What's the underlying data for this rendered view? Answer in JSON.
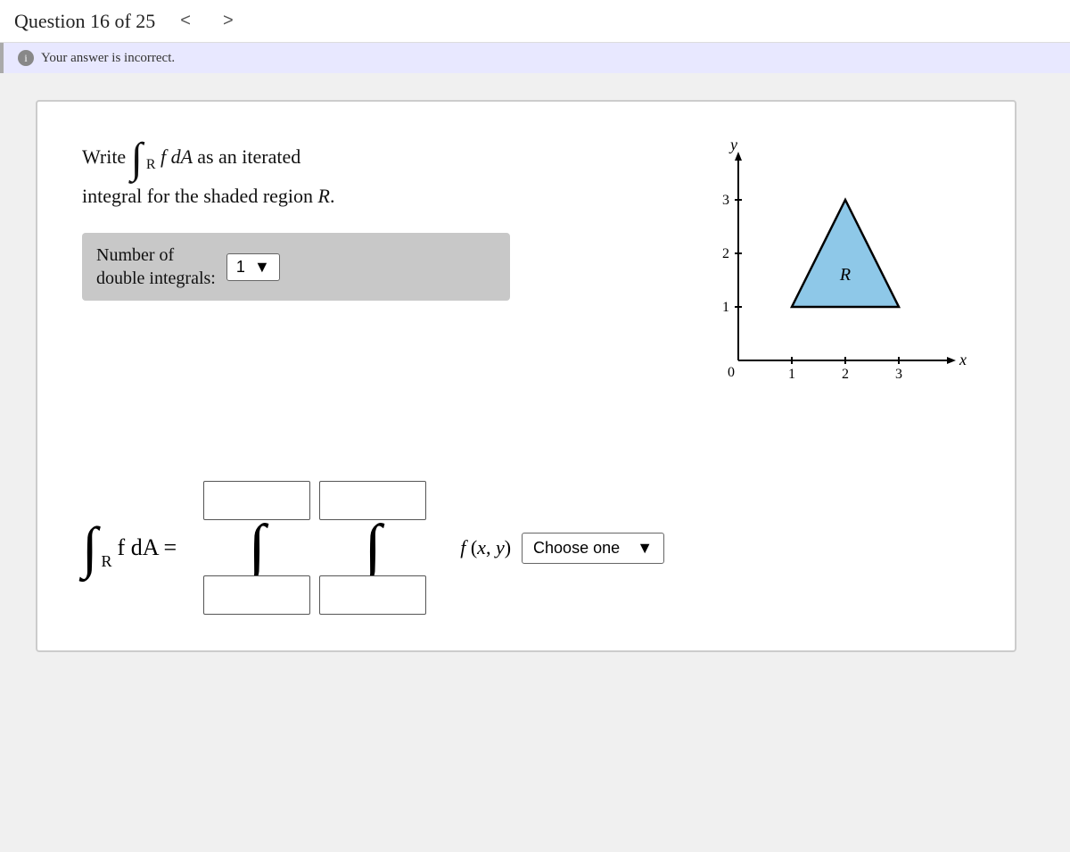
{
  "header": {
    "question_label": "Question 16 of 25",
    "nav_prev": "<",
    "nav_next": ">"
  },
  "banner": {
    "text": "Your answer is incorrect.",
    "icon": "i"
  },
  "question": {
    "write_label": "Write",
    "integral_text": "f dA",
    "subscript": "R",
    "as_text": "as an iterated",
    "integral_line2": "integral for the shaded region",
    "region_label": "R.",
    "number_of_integrals_label": "Number of\ndouble integrals:",
    "dropdown_value": "1",
    "dropdown_arrow": "▼"
  },
  "graph": {
    "y_label": "y",
    "x_label": "x",
    "y_ticks": [
      "3",
      "2",
      "1"
    ],
    "x_ticks": [
      "1",
      "2",
      "3"
    ],
    "origin": "0",
    "region_label": "R"
  },
  "equation": {
    "lhs_integral": "∫",
    "lhs_subscript": "R",
    "lhs_text": "f dA =",
    "integral_sym": "∫",
    "fxy_label": "f (x, y)",
    "choose_label": "Choose one",
    "choose_arrow": "▼",
    "input_placeholder": ""
  }
}
